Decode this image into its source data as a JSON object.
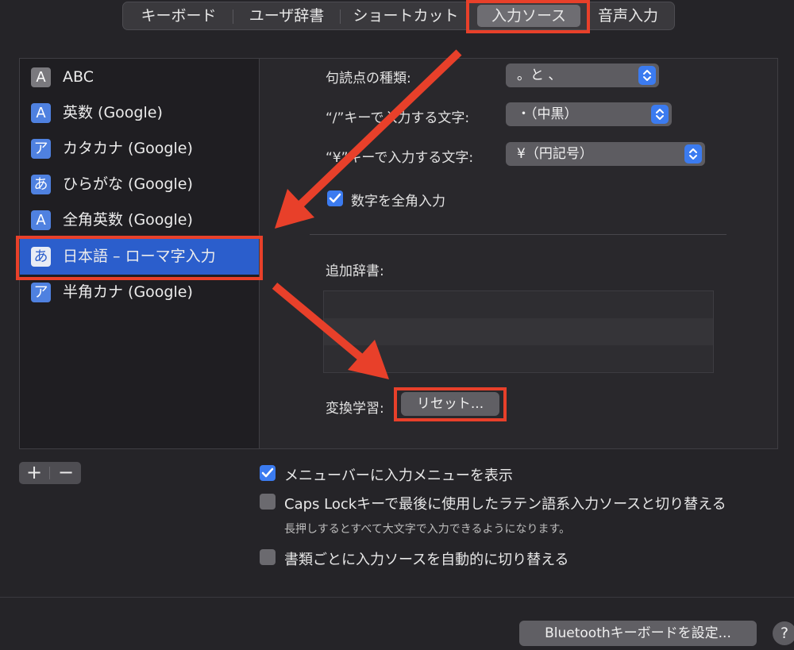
{
  "tabs": [
    {
      "label": "キーボード",
      "active": false
    },
    {
      "label": "ユーザ辞書",
      "active": false
    },
    {
      "label": "ショートカット",
      "active": false
    },
    {
      "label": "入力ソース",
      "active": true
    },
    {
      "label": "音声入力",
      "active": false
    }
  ],
  "sources": [
    {
      "icon": "A",
      "label": "ABC"
    },
    {
      "icon": "A",
      "label": "英数 (Google)"
    },
    {
      "icon": "ア",
      "label": "カタカナ (Google)"
    },
    {
      "icon": "あ",
      "label": "ひらがな (Google)"
    },
    {
      "icon": "A",
      "label": "全角英数 (Google)"
    },
    {
      "icon": "あ",
      "label": "日本語 – ローマ字入力",
      "selected": true
    },
    {
      "icon": "ア",
      "label": "半角カナ (Google)"
    }
  ],
  "detail": {
    "punctuation_label": "句読点の種類:",
    "punctuation_value": "。と 、",
    "slash_label": "“/”キーで入力する文字:",
    "slash_value": "・（中黒）",
    "yen_label": "“¥”キーで入力する文字:",
    "yen_value": "¥（円記号）",
    "fullwidth_numbers_label": "数字を全角入力",
    "fullwidth_numbers_checked": true,
    "dictionary_label": "追加辞書:",
    "learning_label": "変換学習:",
    "reset_button": "リセット..."
  },
  "list_controls": {
    "add": "+",
    "remove": "−"
  },
  "options": {
    "show_menu_label": "メニューバーに入力メニューを表示",
    "show_menu_checked": true,
    "caps_lock_label": "Caps Lockキーで最後に使用したラテン語系入力ソースと切り替える",
    "caps_lock_checked": false,
    "caps_lock_hint": "長押しするとすべて大文字で入力できるようになります。",
    "auto_switch_label": "書類ごとに入力ソースを自動的に切り替える",
    "auto_switch_checked": false
  },
  "footer": {
    "bluetooth_button": "Bluetoothキーボードを設定...",
    "help": "?"
  },
  "colors": {
    "accent": "#3b7bf0",
    "selection": "#2b5ecc",
    "annotation": "#e8402a"
  },
  "icons": {
    "popup": "chevron-up-down-icon",
    "checkbox": "checkmark-icon",
    "arrows": "annotation-arrow-icon"
  }
}
